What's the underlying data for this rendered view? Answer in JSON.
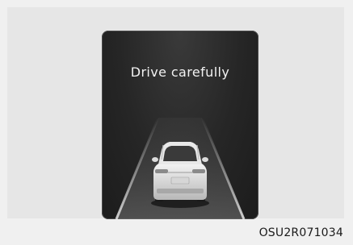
{
  "display": {
    "message": "Drive carefully",
    "icon": "car-on-road-icon"
  },
  "caption": "OSU2R071034",
  "colors": {
    "background": "#f0f0f0",
    "panel": "#262626",
    "text": "#f2f2f2"
  }
}
